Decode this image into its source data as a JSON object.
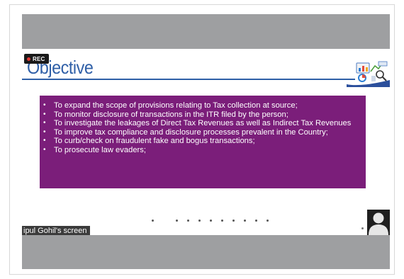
{
  "recording": {
    "label": "REC"
  },
  "slide": {
    "title": "Objective",
    "bullets": [
      "To expand the scope of provisions relating to Tax collection at source;",
      "To monitor disclosure of transactions in the ITR filed by the person;",
      "To investigate the leakages of Direct Tax Revenues as well as Indirect Tax Revenues",
      "To improve tax compliance and disclosure processes prevalent in the Country;",
      "To curb/check on fraudulent  fake and bogus transactions;",
      "To prosecute law evaders;"
    ],
    "box_color": "#7b1e7a",
    "title_color": "#2f5fa7"
  },
  "screen_share": {
    "label": "ipul Gohil's screen"
  },
  "icons": {
    "recording": "record-dot-icon",
    "logo": "tax-analytics-logo-icon",
    "avatar": "user-avatar-icon"
  }
}
